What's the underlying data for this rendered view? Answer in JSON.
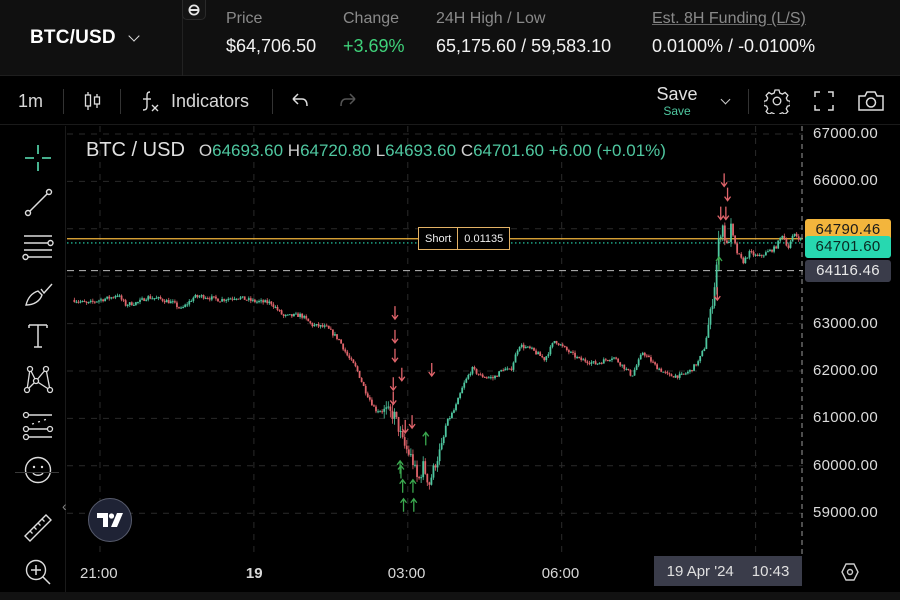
{
  "header": {
    "symbol": "BTC/USD",
    "stats": [
      {
        "label": "Price",
        "value": "$64,706.50",
        "accent": false,
        "underline": false
      },
      {
        "label": "Change",
        "value": "+3.69%",
        "accent": true,
        "underline": false
      },
      {
        "label": "24H High / Low",
        "value": "65,175.60 / 59,583.10",
        "accent": false,
        "underline": false
      },
      {
        "label": "Est. 8H Funding (L/S)",
        "value": "0.0100% / -0.0100%",
        "accent": false,
        "underline": true
      }
    ]
  },
  "toolbar": {
    "interval": "1m",
    "indicators_label": "Indicators",
    "save_label": "Save",
    "save_sublabel": "Save"
  },
  "left_tools": [
    {
      "name": "crosshair-tool",
      "icon": "crosshair-icon"
    },
    {
      "name": "trend-line-tool",
      "icon": "trend-line-icon"
    },
    {
      "name": "fib-tool",
      "icon": "fib-retracement-icon"
    },
    {
      "name": "brush-tool",
      "icon": "brush-icon"
    },
    {
      "name": "text-tool",
      "icon": "text-icon"
    },
    {
      "name": "pattern-tool",
      "icon": "pattern-icon"
    },
    {
      "name": "prediction-tool",
      "icon": "forecast-icon"
    },
    {
      "name": "emoji-tool",
      "icon": "smiley-icon"
    },
    {
      "name": "measure-tool",
      "icon": "ruler-icon"
    },
    {
      "name": "zoom-tool",
      "icon": "zoom-in-icon"
    }
  ],
  "legend": {
    "title": "BTC / USD",
    "open_label": "O",
    "open": "64693.60",
    "high_label": "H",
    "high": "64720.80",
    "low_label": "L",
    "low": "64693.60",
    "close_label": "C",
    "close": "64701.60",
    "change": "+6.00 (+0.01%)"
  },
  "order": {
    "side": "Short",
    "size": "0.01135"
  },
  "price_labels": {
    "order_price": "64790.46",
    "last_price": "64701.60",
    "crosshair_price": "64116.46"
  },
  "colors": {
    "up": "#4fc7a0",
    "down": "#e0646b",
    "order_line": "#f3b53c",
    "last_price": "#27d8b0",
    "crosshair_label": "#3a3c4a",
    "signal_buy": "#3aa84e",
    "signal_sell": "#e0646b"
  },
  "time_label": {
    "date": "19 Apr '24",
    "time": "10:43"
  },
  "chart_data": {
    "type": "candlestick",
    "title": "BTC / USD",
    "interval": "1m",
    "y_ticks": [
      "67000.00",
      "66000.00",
      "63000.00",
      "62000.00",
      "61000.00",
      "60000.00",
      "59000.00"
    ],
    "y_tick_values": [
      67000,
      66000,
      63000,
      62000,
      61000,
      60000,
      59000
    ],
    "ylim": [
      58600,
      67050
    ],
    "x_ticks": [
      {
        "label": "21:00",
        "minutes": 0,
        "bold": false
      },
      {
        "label": "19",
        "minutes": 180,
        "bold": true
      },
      {
        "label": "03:00",
        "minutes": 360,
        "bold": false
      },
      {
        "label": "06:00",
        "minutes": 540,
        "bold": false
      }
    ],
    "xlim_minutes": [
      -30,
      823
    ],
    "price_path": [
      [
        -30,
        63500
      ],
      [
        -15,
        63420
      ],
      [
        0,
        63500
      ],
      [
        15,
        63560
      ],
      [
        20,
        63620
      ],
      [
        30,
        63400
      ],
      [
        45,
        63450
      ],
      [
        55,
        63560
      ],
      [
        70,
        63520
      ],
      [
        85,
        63440
      ],
      [
        95,
        63300
      ],
      [
        110,
        63560
      ],
      [
        120,
        63580
      ],
      [
        140,
        63500
      ],
      [
        160,
        63560
      ],
      [
        180,
        63470
      ],
      [
        200,
        63440
      ],
      [
        215,
        63150
      ],
      [
        235,
        63180
      ],
      [
        248,
        62970
      ],
      [
        265,
        62920
      ],
      [
        280,
        62650
      ],
      [
        290,
        62300
      ],
      [
        300,
        62050
      ],
      [
        310,
        61600
      ],
      [
        322,
        61180
      ],
      [
        335,
        61150
      ],
      [
        345,
        61050
      ],
      [
        355,
        60450
      ],
      [
        365,
        60150
      ],
      [
        372,
        59650
      ],
      [
        378,
        60000
      ],
      [
        385,
        59620
      ],
      [
        393,
        60100
      ],
      [
        400,
        60400
      ],
      [
        405,
        60900
      ],
      [
        415,
        61200
      ],
      [
        425,
        61700
      ],
      [
        435,
        62050
      ],
      [
        445,
        61900
      ],
      [
        460,
        61850
      ],
      [
        472,
        62050
      ],
      [
        480,
        62000
      ],
      [
        490,
        62550
      ],
      [
        505,
        62450
      ],
      [
        520,
        62250
      ],
      [
        532,
        62650
      ],
      [
        545,
        62450
      ],
      [
        560,
        62250
      ],
      [
        572,
        62200
      ],
      [
        580,
        62150
      ],
      [
        600,
        62300
      ],
      [
        612,
        62100
      ],
      [
        622,
        61900
      ],
      [
        635,
        62400
      ],
      [
        650,
        62100
      ],
      [
        665,
        61900
      ],
      [
        680,
        61900
      ],
      [
        690,
        62000
      ],
      [
        700,
        62200
      ],
      [
        707,
        62500
      ],
      [
        715,
        63300
      ],
      [
        720,
        64000
      ],
      [
        724,
        64800
      ],
      [
        728,
        65100
      ],
      [
        733,
        64600
      ],
      [
        738,
        65000
      ],
      [
        745,
        64500
      ],
      [
        752,
        64300
      ],
      [
        760,
        64500
      ],
      [
        770,
        64400
      ],
      [
        780,
        64500
      ],
      [
        790,
        64600
      ],
      [
        798,
        64880
      ],
      [
        805,
        64600
      ],
      [
        812,
        64900
      ],
      [
        818,
        64800
      ],
      [
        823,
        64700
      ]
    ],
    "sell_signals_minutes": [
      [
        345,
        63200
      ],
      [
        345,
        62700
      ],
      [
        345,
        62300
      ],
      [
        343,
        61700
      ],
      [
        343,
        61400
      ],
      [
        353,
        61900
      ],
      [
        357,
        60800
      ],
      [
        365,
        60900
      ],
      [
        388,
        62000
      ],
      [
        730,
        66000
      ],
      [
        734,
        65700
      ],
      [
        726,
        65300
      ],
      [
        732,
        65300
      ],
      [
        722,
        63600
      ]
    ],
    "buy_signals_minutes": [
      [
        351,
        60000
      ],
      [
        352,
        59900
      ],
      [
        354,
        59600
      ],
      [
        366,
        59600
      ],
      [
        355,
        59200
      ],
      [
        367,
        59200
      ],
      [
        381,
        60600
      ],
      [
        724,
        64300
      ]
    ],
    "horizontal_lines": [
      {
        "name": "order-line",
        "price": 64790.46,
        "style": "solid"
      },
      {
        "name": "last-price-line",
        "price": 64701.6,
        "style": "dotted"
      },
      {
        "name": "crosshair-line",
        "price": 64116.46,
        "style": "dashed"
      }
    ],
    "crosshair_time": "19 Apr '24 10:43"
  }
}
